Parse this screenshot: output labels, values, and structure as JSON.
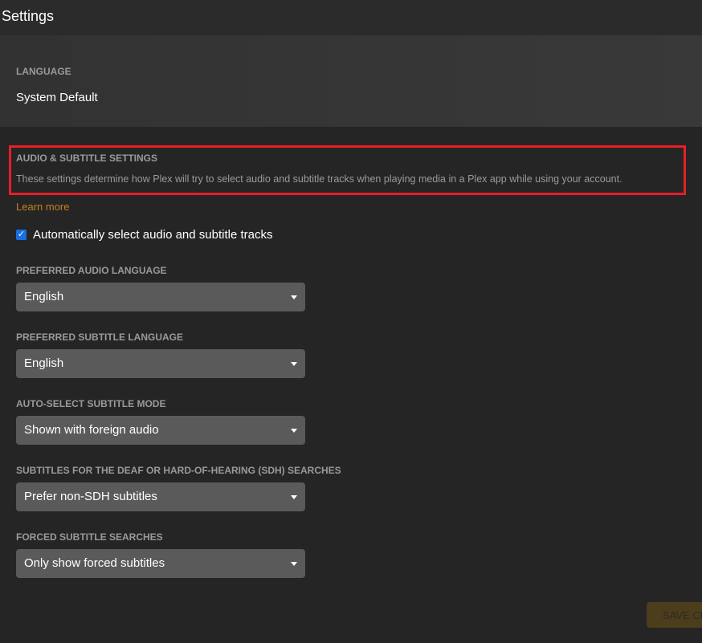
{
  "header": {
    "title": "Settings"
  },
  "language": {
    "label": "LANGUAGE",
    "value": "System Default"
  },
  "audio_subtitle": {
    "heading": "AUDIO & SUBTITLE SETTINGS",
    "description": "These settings determine how Plex will try to select audio and subtitle tracks when playing media in a Plex app while using your account.",
    "learn_more": "Learn more",
    "auto_select_label": "Automatically select audio and subtitle tracks",
    "auto_select_checked": true,
    "fields": [
      {
        "label": "PREFERRED AUDIO LANGUAGE",
        "value": "English"
      },
      {
        "label": "PREFERRED SUBTITLE LANGUAGE",
        "value": "English"
      },
      {
        "label": "AUTO-SELECT SUBTITLE MODE",
        "value": "Shown with foreign audio"
      },
      {
        "label": "SUBTITLES FOR THE DEAF OR HARD-OF-HEARING (SDH) SEARCHES",
        "value": "Prefer non-SDH subtitles"
      },
      {
        "label": "FORCED SUBTITLE SEARCHES",
        "value": "Only show forced subtitles"
      }
    ]
  },
  "save_button": "SAVE CHANGES",
  "colors": {
    "accent": "#c5811d",
    "highlight": "#e81e28",
    "checkbox": "#1a6fe0"
  }
}
